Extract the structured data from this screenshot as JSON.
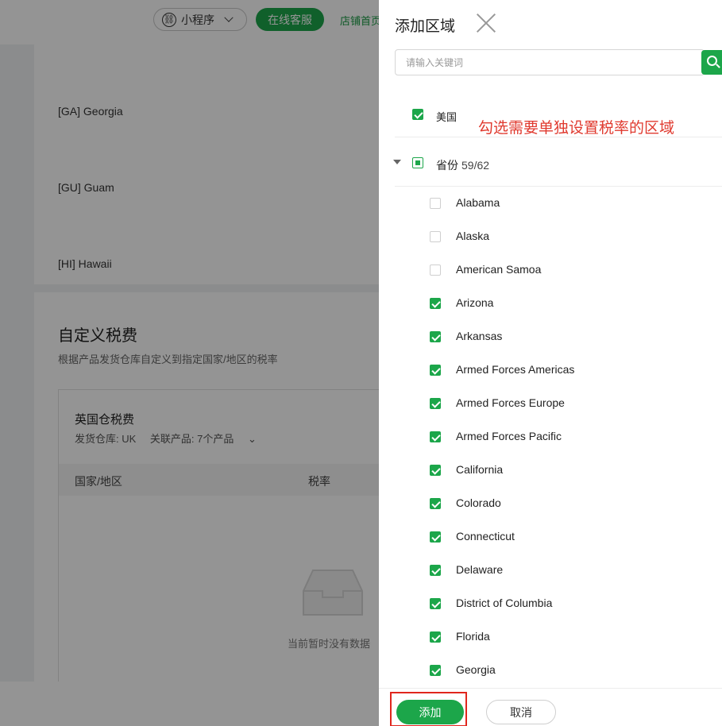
{
  "background": {
    "topbar": {
      "mini_program_label": "小程序",
      "online_service_label": "在线客服",
      "store_home_label": "店铺首页"
    },
    "region_rows": [
      "[GA] Georgia",
      "[GU] Guam",
      "[HI] Hawaii"
    ],
    "custom_tax": {
      "title": "自定义税费",
      "description": "根据产品发货仓库自定义到指定国家/地区的税率",
      "uk_title": "英国仓税费",
      "warehouse": "发货仓库: UK",
      "related_products": "关联产品: 7个产品",
      "col_region": "国家/地区",
      "col_rate": "税率",
      "empty_text": "当前暂时没有数据"
    }
  },
  "drawer": {
    "title": "添加区域",
    "search_placeholder": "请输入关键词",
    "country": {
      "label": "美国",
      "checked": true
    },
    "annotation": "勾选需要单独设置税率的区域",
    "province": {
      "label": "省份",
      "count": "59/62",
      "state": "partial"
    },
    "states": [
      {
        "name": "Alabama",
        "checked": false
      },
      {
        "name": "Alaska",
        "checked": false
      },
      {
        "name": "American Samoa",
        "checked": false
      },
      {
        "name": "Arizona",
        "checked": true
      },
      {
        "name": "Arkansas",
        "checked": true
      },
      {
        "name": "Armed Forces Americas",
        "checked": true
      },
      {
        "name": "Armed Forces Europe",
        "checked": true
      },
      {
        "name": "Armed Forces Pacific",
        "checked": true
      },
      {
        "name": "California",
        "checked": true
      },
      {
        "name": "Colorado",
        "checked": true
      },
      {
        "name": "Connecticut",
        "checked": true
      },
      {
        "name": "Delaware",
        "checked": true
      },
      {
        "name": "District of Columbia",
        "checked": true
      },
      {
        "name": "Florida",
        "checked": true
      },
      {
        "name": "Georgia",
        "checked": true
      }
    ],
    "add_label": "添加",
    "cancel_label": "取消"
  },
  "colors": {
    "accent": "#1ca64a",
    "annotation": "#e03a2f",
    "highlight_border": "#e0261d"
  },
  "icons": {
    "close": "close-icon",
    "search": "search-icon",
    "expand": "caret-down-icon",
    "mini_program": "link-icon",
    "empty": "empty-inbox-icon"
  }
}
